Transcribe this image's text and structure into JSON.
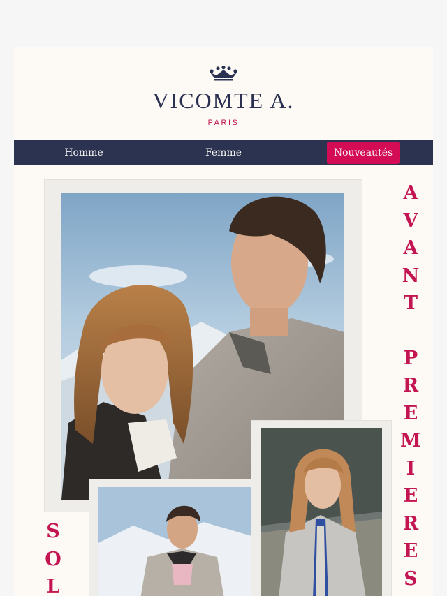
{
  "brand": {
    "name": "VICOMTE A.",
    "city": "PARIS",
    "icon": "crown-icon"
  },
  "nav": {
    "items": [
      {
        "label": "Homme",
        "highlighted": false
      },
      {
        "label": "Femme",
        "highlighted": false
      },
      {
        "label": "Nouveautés",
        "highlighted": true
      }
    ]
  },
  "headline_vertical": {
    "line1": [
      "A",
      "V",
      "A",
      "N",
      "T"
    ],
    "line2": [
      "P",
      "R",
      "E",
      "M",
      "I",
      "E",
      "R",
      "E",
      "S"
    ]
  },
  "side_vertical": {
    "letters": [
      "S",
      "O",
      "L"
    ]
  },
  "colors": {
    "navy": "#2b3350",
    "accent": "#d40c55",
    "text_accent": "#c41553",
    "background": "#fdfaf6"
  }
}
